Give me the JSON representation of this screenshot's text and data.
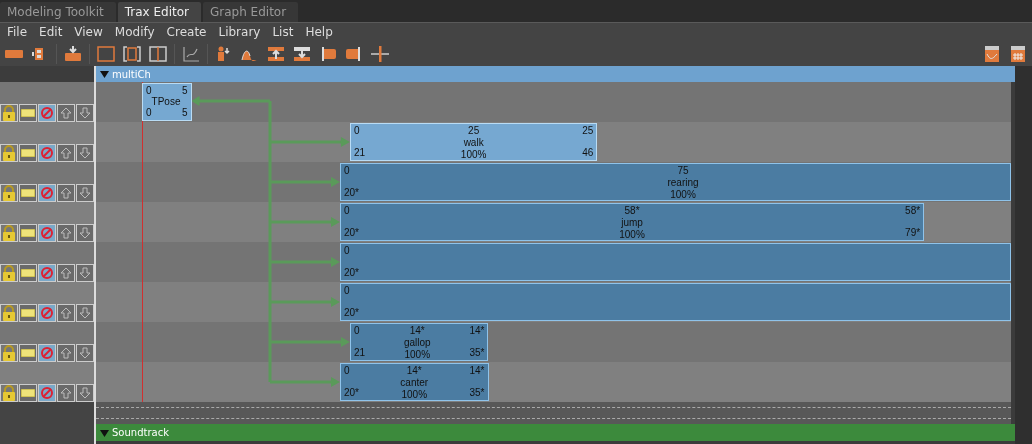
{
  "tabs": [
    {
      "label": "Modeling Toolkit",
      "selected": false
    },
    {
      "label": "Trax Editor",
      "selected": true
    },
    {
      "label": "Graph Editor",
      "selected": false
    }
  ],
  "menu": [
    "File",
    "Edit",
    "View",
    "Modify",
    "Create",
    "Library",
    "List",
    "Help"
  ],
  "character": {
    "name": "multiCh",
    "expanded": true
  },
  "tracks": [
    {
      "clips": [
        {
          "name": "TPose",
          "source_start": "0",
          "source_end": "5",
          "start": "0",
          "end": "5",
          "selected": true
        }
      ]
    },
    {
      "clips": [
        {
          "name": "walk",
          "source_start": "0",
          "source_end": "25",
          "start": "21",
          "end": "46",
          "duration": "25",
          "scale": "100%",
          "selected": true
        }
      ]
    },
    {
      "clips": [
        {
          "name": "rearing",
          "source_start": "0",
          "start": "20*",
          "duration": "75",
          "scale": "100%",
          "selected": false
        }
      ]
    },
    {
      "clips": [
        {
          "name": "jump",
          "source_start": "0",
          "source_end": "58*",
          "start": "20*",
          "end": "79*",
          "duration": "58*",
          "scale": "100%",
          "selected": false
        }
      ]
    },
    {
      "clips": [
        {
          "source_start": "0",
          "start": "20*",
          "selected": false
        }
      ]
    },
    {
      "clips": [
        {
          "source_start": "0",
          "start": "20*",
          "selected": false
        }
      ]
    },
    {
      "clips": [
        {
          "name": "gallop",
          "source_start": "0",
          "source_end": "14*",
          "start": "21",
          "end": "35*",
          "duration": "14*",
          "scale": "100%",
          "selected": false
        }
      ]
    },
    {
      "clips": [
        {
          "name": "canter",
          "source_start": "0",
          "source_end": "14*",
          "start": "20*",
          "end": "35*",
          "duration": "14*",
          "scale": "100%",
          "selected": false
        }
      ]
    }
  ],
  "soundtrack": {
    "label": "Soundtrack",
    "expanded": true
  }
}
